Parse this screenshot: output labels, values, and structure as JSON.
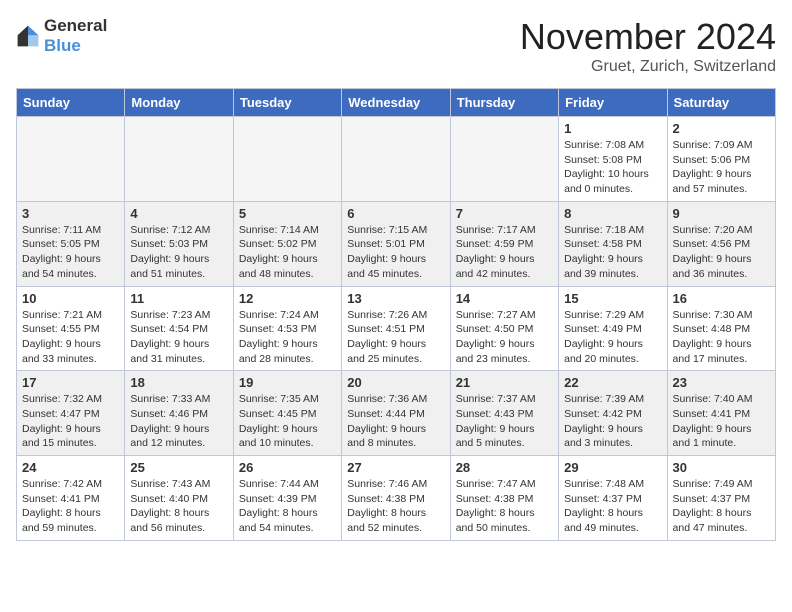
{
  "logo": {
    "text_general": "General",
    "text_blue": "Blue"
  },
  "header": {
    "month": "November 2024",
    "location": "Gruet, Zurich, Switzerland"
  },
  "weekdays": [
    "Sunday",
    "Monday",
    "Tuesday",
    "Wednesday",
    "Thursday",
    "Friday",
    "Saturday"
  ],
  "weeks": [
    [
      {
        "day": "",
        "info": ""
      },
      {
        "day": "",
        "info": ""
      },
      {
        "day": "",
        "info": ""
      },
      {
        "day": "",
        "info": ""
      },
      {
        "day": "",
        "info": ""
      },
      {
        "day": "1",
        "info": "Sunrise: 7:08 AM\nSunset: 5:08 PM\nDaylight: 10 hours\nand 0 minutes."
      },
      {
        "day": "2",
        "info": "Sunrise: 7:09 AM\nSunset: 5:06 PM\nDaylight: 9 hours\nand 57 minutes."
      }
    ],
    [
      {
        "day": "3",
        "info": "Sunrise: 7:11 AM\nSunset: 5:05 PM\nDaylight: 9 hours\nand 54 minutes."
      },
      {
        "day": "4",
        "info": "Sunrise: 7:12 AM\nSunset: 5:03 PM\nDaylight: 9 hours\nand 51 minutes."
      },
      {
        "day": "5",
        "info": "Sunrise: 7:14 AM\nSunset: 5:02 PM\nDaylight: 9 hours\nand 48 minutes."
      },
      {
        "day": "6",
        "info": "Sunrise: 7:15 AM\nSunset: 5:01 PM\nDaylight: 9 hours\nand 45 minutes."
      },
      {
        "day": "7",
        "info": "Sunrise: 7:17 AM\nSunset: 4:59 PM\nDaylight: 9 hours\nand 42 minutes."
      },
      {
        "day": "8",
        "info": "Sunrise: 7:18 AM\nSunset: 4:58 PM\nDaylight: 9 hours\nand 39 minutes."
      },
      {
        "day": "9",
        "info": "Sunrise: 7:20 AM\nSunset: 4:56 PM\nDaylight: 9 hours\nand 36 minutes."
      }
    ],
    [
      {
        "day": "10",
        "info": "Sunrise: 7:21 AM\nSunset: 4:55 PM\nDaylight: 9 hours\nand 33 minutes."
      },
      {
        "day": "11",
        "info": "Sunrise: 7:23 AM\nSunset: 4:54 PM\nDaylight: 9 hours\nand 31 minutes."
      },
      {
        "day": "12",
        "info": "Sunrise: 7:24 AM\nSunset: 4:53 PM\nDaylight: 9 hours\nand 28 minutes."
      },
      {
        "day": "13",
        "info": "Sunrise: 7:26 AM\nSunset: 4:51 PM\nDaylight: 9 hours\nand 25 minutes."
      },
      {
        "day": "14",
        "info": "Sunrise: 7:27 AM\nSunset: 4:50 PM\nDaylight: 9 hours\nand 23 minutes."
      },
      {
        "day": "15",
        "info": "Sunrise: 7:29 AM\nSunset: 4:49 PM\nDaylight: 9 hours\nand 20 minutes."
      },
      {
        "day": "16",
        "info": "Sunrise: 7:30 AM\nSunset: 4:48 PM\nDaylight: 9 hours\nand 17 minutes."
      }
    ],
    [
      {
        "day": "17",
        "info": "Sunrise: 7:32 AM\nSunset: 4:47 PM\nDaylight: 9 hours\nand 15 minutes."
      },
      {
        "day": "18",
        "info": "Sunrise: 7:33 AM\nSunset: 4:46 PM\nDaylight: 9 hours\nand 12 minutes."
      },
      {
        "day": "19",
        "info": "Sunrise: 7:35 AM\nSunset: 4:45 PM\nDaylight: 9 hours\nand 10 minutes."
      },
      {
        "day": "20",
        "info": "Sunrise: 7:36 AM\nSunset: 4:44 PM\nDaylight: 9 hours\nand 8 minutes."
      },
      {
        "day": "21",
        "info": "Sunrise: 7:37 AM\nSunset: 4:43 PM\nDaylight: 9 hours\nand 5 minutes."
      },
      {
        "day": "22",
        "info": "Sunrise: 7:39 AM\nSunset: 4:42 PM\nDaylight: 9 hours\nand 3 minutes."
      },
      {
        "day": "23",
        "info": "Sunrise: 7:40 AM\nSunset: 4:41 PM\nDaylight: 9 hours\nand 1 minute."
      }
    ],
    [
      {
        "day": "24",
        "info": "Sunrise: 7:42 AM\nSunset: 4:41 PM\nDaylight: 8 hours\nand 59 minutes."
      },
      {
        "day": "25",
        "info": "Sunrise: 7:43 AM\nSunset: 4:40 PM\nDaylight: 8 hours\nand 56 minutes."
      },
      {
        "day": "26",
        "info": "Sunrise: 7:44 AM\nSunset: 4:39 PM\nDaylight: 8 hours\nand 54 minutes."
      },
      {
        "day": "27",
        "info": "Sunrise: 7:46 AM\nSunset: 4:38 PM\nDaylight: 8 hours\nand 52 minutes."
      },
      {
        "day": "28",
        "info": "Sunrise: 7:47 AM\nSunset: 4:38 PM\nDaylight: 8 hours\nand 50 minutes."
      },
      {
        "day": "29",
        "info": "Sunrise: 7:48 AM\nSunset: 4:37 PM\nDaylight: 8 hours\nand 49 minutes."
      },
      {
        "day": "30",
        "info": "Sunrise: 7:49 AM\nSunset: 4:37 PM\nDaylight: 8 hours\nand 47 minutes."
      }
    ]
  ]
}
